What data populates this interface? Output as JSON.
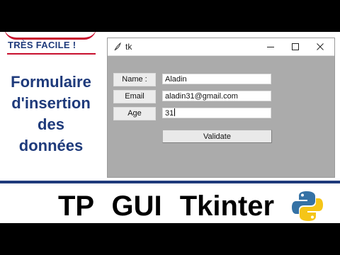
{
  "badge": {
    "text": "TRÈS FACILE !"
  },
  "headline": {
    "lines": [
      "Formulaire",
      "d'insertion",
      "des",
      "données"
    ]
  },
  "window": {
    "title": "tk",
    "form": {
      "name_label": "Name :",
      "name_value": "Aladin",
      "email_label": "Email",
      "email_value": "aladin31@gmail.com",
      "age_label": "Age",
      "age_value": "31",
      "validate_label": "Validate"
    }
  },
  "footer": {
    "title": "TP GUI Tkinter"
  },
  "colors": {
    "accent_blue": "#1e3a7b",
    "accent_red": "#c8102e",
    "window_bg": "#ababab"
  }
}
